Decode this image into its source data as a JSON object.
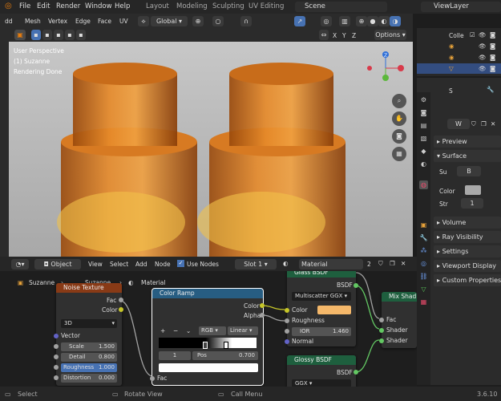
{
  "menu": {
    "file": "File",
    "edit": "Edit",
    "render": "Render",
    "window": "Window",
    "help": "Help"
  },
  "workspaces": {
    "layout": "Layout",
    "modeling": "Modeling",
    "sculpting": "Sculpting",
    "uv_editing": "UV Editing"
  },
  "scene": "Scene",
  "view_layer": "ViewLayer",
  "viewport_menu": {
    "add": "dd",
    "mesh": "Mesh",
    "vertex": "Vertex",
    "edge": "Edge",
    "face": "Face",
    "uv": "UV",
    "global": "Global"
  },
  "viewport": {
    "perspective": "User Perspective",
    "object": "(1) Suzanne",
    "status": "Rendering Done",
    "options": "Options",
    "axes": {
      "x": "X",
      "y": "Y",
      "z": "Z"
    }
  },
  "outliner": {
    "coll_label": "Colle"
  },
  "properties": {
    "s_label": "S",
    "material_label": "W",
    "preview": "Preview",
    "surface": "Surface",
    "surface_field": "Su",
    "surface_value": "B",
    "color_label": "Color",
    "strength_label": "Str",
    "strength_value": "1",
    "volume": "Volume",
    "ray_visibility": "Ray Visibility",
    "settings": "Settings",
    "viewport_display": "Viewport Display",
    "custom_properties": "Custom Properties"
  },
  "node_editor_header": {
    "mode": "Object",
    "view": "View",
    "select": "Select",
    "add": "Add",
    "node": "Node",
    "use_nodes": "Use Nodes",
    "slot": "Slot 1",
    "material": "Material",
    "users": "2"
  },
  "breadcrumb": {
    "object": "Suzanne",
    "mesh": "Suzanne",
    "material": "Material"
  },
  "nodes": {
    "noise": {
      "title": "Noise Texture",
      "out_fac": "Fac",
      "out_color": "Color",
      "dims": "3D",
      "vector": "Vector",
      "scale_label": "Scale",
      "scale": "1.500",
      "detail_label": "Detail",
      "detail": "0.800",
      "roughness_label": "Roughness",
      "roughness": "1.000",
      "distortion_label": "Distortion",
      "distortion": "0.000"
    },
    "ramp": {
      "title": "Color Ramp",
      "out_color": "Color",
      "out_alpha": "Alpha",
      "plus": "+",
      "minus": "−",
      "color_mode": "RGB",
      "interp": "Linear",
      "stop_index": "1",
      "pos_label": "Pos",
      "pos_value": "0.700",
      "in_fac": "Fac"
    },
    "glass": {
      "title": "Glass BSDF",
      "out": "BSDF",
      "dist": "Multiscatter GGX",
      "color_label": "Color",
      "color": "#f5b86a",
      "roughness": "Roughness",
      "ior_label": "IOR",
      "ior": "1.460",
      "normal": "Normal"
    },
    "mix": {
      "title": "Mix Shad",
      "fac": "Fac",
      "shader1": "Shader",
      "shader2": "Shader"
    },
    "glossy": {
      "title": "Glossy BSDF",
      "out": "BSDF",
      "dist": "GGX"
    }
  },
  "status": {
    "select": "Select",
    "rotate": "Rotate View",
    "call_menu": "Call Menu",
    "version": "3.6.10"
  },
  "colors": {
    "accent": "#4772b3",
    "node_green": "#1e5f3e",
    "node_blue": "#275d82",
    "node_orange": "#883a16",
    "socket_yellow": "#c7c729",
    "socket_gray": "#a1a1a1",
    "socket_purple": "#6363c7",
    "socket_green": "#63c763",
    "bottle": "#e07b1a"
  }
}
